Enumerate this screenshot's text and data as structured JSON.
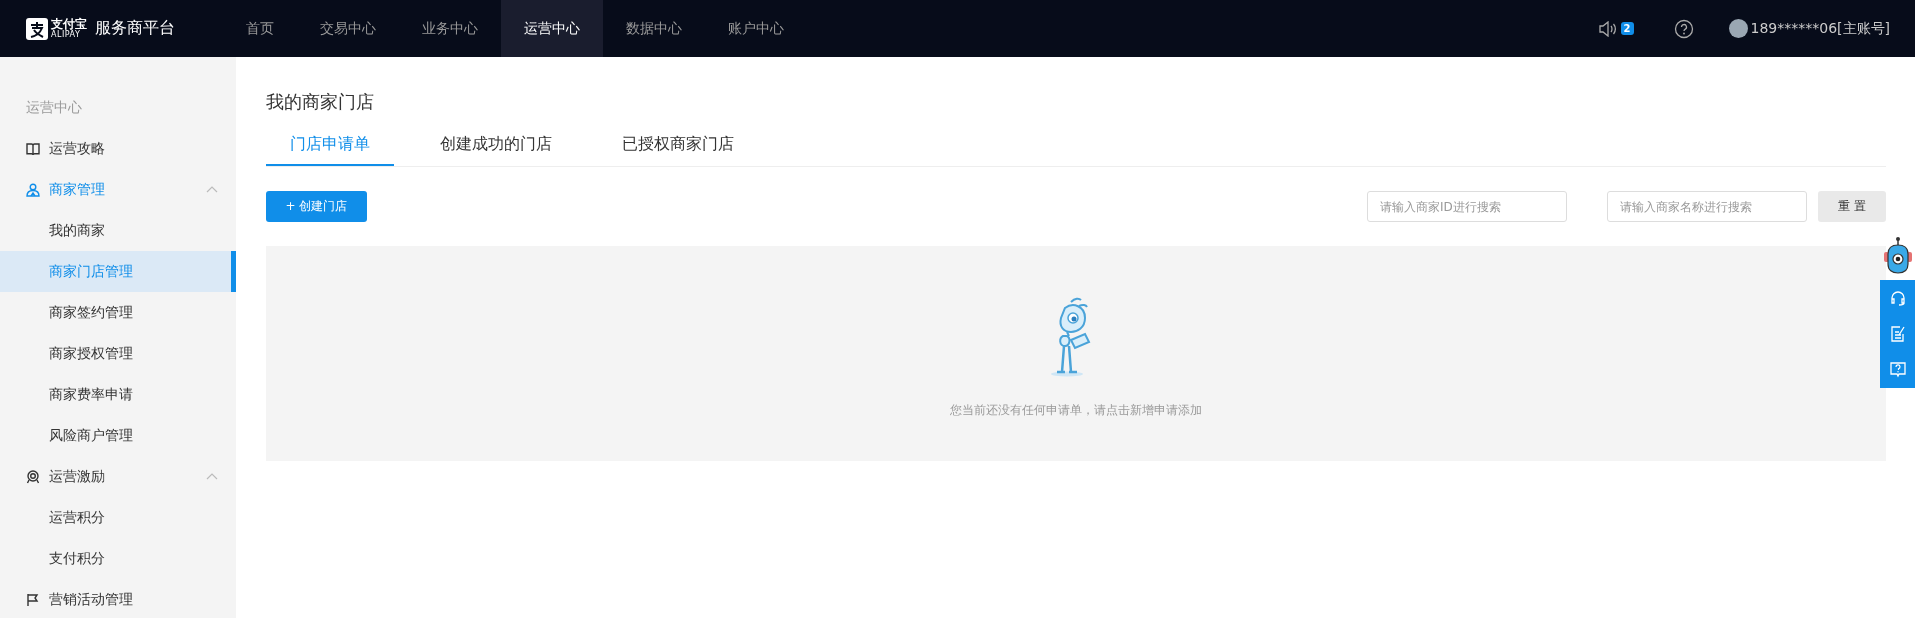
{
  "top_nav": {
    "logo": {
      "brand": "支付宝",
      "brand_sub": "ALIPAY"
    },
    "title": "服务商平台",
    "items": [
      {
        "label": "首页",
        "selected": false
      },
      {
        "label": "交易中心",
        "selected": false
      },
      {
        "label": "业务中心",
        "selected": false
      },
      {
        "label": "运营中心",
        "selected": true
      },
      {
        "label": "数据中心",
        "selected": false
      },
      {
        "label": "账户中心",
        "selected": false
      }
    ],
    "notifications": {
      "count": "2"
    },
    "user": {
      "name": "189******06[主账号]"
    }
  },
  "sidebar": {
    "heading": "运营中心",
    "items": [
      {
        "label": "运营攻略"
      },
      {
        "label": "商家管理",
        "expanded": true,
        "children": [
          {
            "label": "我的商家",
            "selected": false
          },
          {
            "label": "商家门店管理",
            "selected": true
          },
          {
            "label": "商家签约管理",
            "selected": false
          },
          {
            "label": "商家授权管理",
            "selected": false
          },
          {
            "label": "商家费率申请",
            "selected": false
          },
          {
            "label": "风险商户管理",
            "selected": false
          }
        ]
      },
      {
        "label": "运营激励",
        "expanded": true,
        "children": [
          {
            "label": "运营积分",
            "selected": false
          },
          {
            "label": "支付积分",
            "selected": false
          }
        ]
      },
      {
        "label": "营销活动管理"
      }
    ]
  },
  "page": {
    "title": "我的商家门店",
    "tabs": [
      {
        "label": "门店申请单",
        "selected": true
      },
      {
        "label": "创建成功的门店",
        "selected": false
      },
      {
        "label": "已授权商家门店",
        "selected": false
      }
    ],
    "create_button": "+ 创建门店",
    "search_fields": [
      {
        "placeholder": "请输入商家ID进行搜索"
      },
      {
        "placeholder": "请输入商家名称进行搜索"
      }
    ],
    "reset_button": "重 置",
    "empty_state": {
      "message": "您当前还没有任何申请单，请点击新增申请添加"
    }
  }
}
